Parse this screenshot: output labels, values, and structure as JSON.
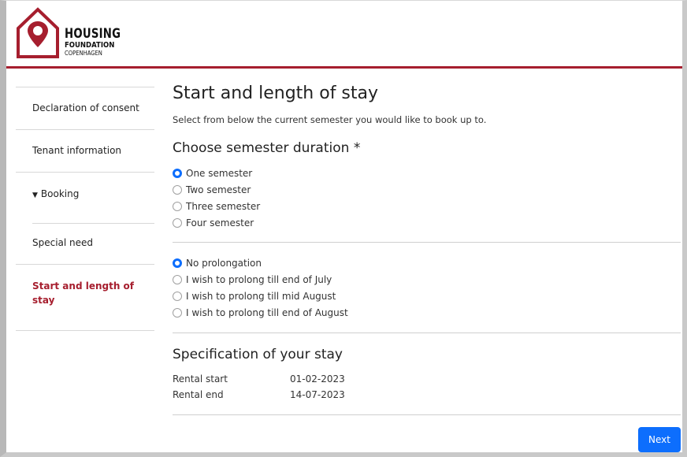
{
  "header": {
    "logo": {
      "line1": "HOUSING",
      "line2": "FOUNDATION",
      "line3": "COPENHAGEN"
    },
    "brand_color": "#a61e2e"
  },
  "sidebar": {
    "items": [
      {
        "label": "Declaration of consent",
        "active": false
      },
      {
        "label": "Tenant information",
        "active": false
      },
      {
        "label": "Booking",
        "active": false,
        "expanded": true
      },
      {
        "label": "Special need",
        "active": false
      },
      {
        "label": "Start and length of stay",
        "active": true
      }
    ],
    "booking_caret": "▼"
  },
  "main": {
    "title": "Start and length of stay",
    "subtitle": "Select from below the current semester you would like to book up to.",
    "duration": {
      "heading": "Choose semester duration *",
      "options": [
        "One semester",
        "Two semester",
        "Three semester",
        "Four semester"
      ],
      "selected": "One semester"
    },
    "prolongation": {
      "options": [
        "No prolongation",
        "I wish to prolong till end of July",
        "I wish to prolong till mid August",
        "I wish to prolong till end of August"
      ],
      "selected": "No prolongation"
    },
    "specification": {
      "heading": "Specification of your stay",
      "rows": [
        {
          "label": "Rental start",
          "value": "01-02-2023"
        },
        {
          "label": "Rental end",
          "value": "14-07-2023"
        }
      ]
    }
  },
  "footer": {
    "next_label": "Next"
  },
  "colors": {
    "accent": "#0d6efd",
    "active_nav": "#a61e2e"
  }
}
